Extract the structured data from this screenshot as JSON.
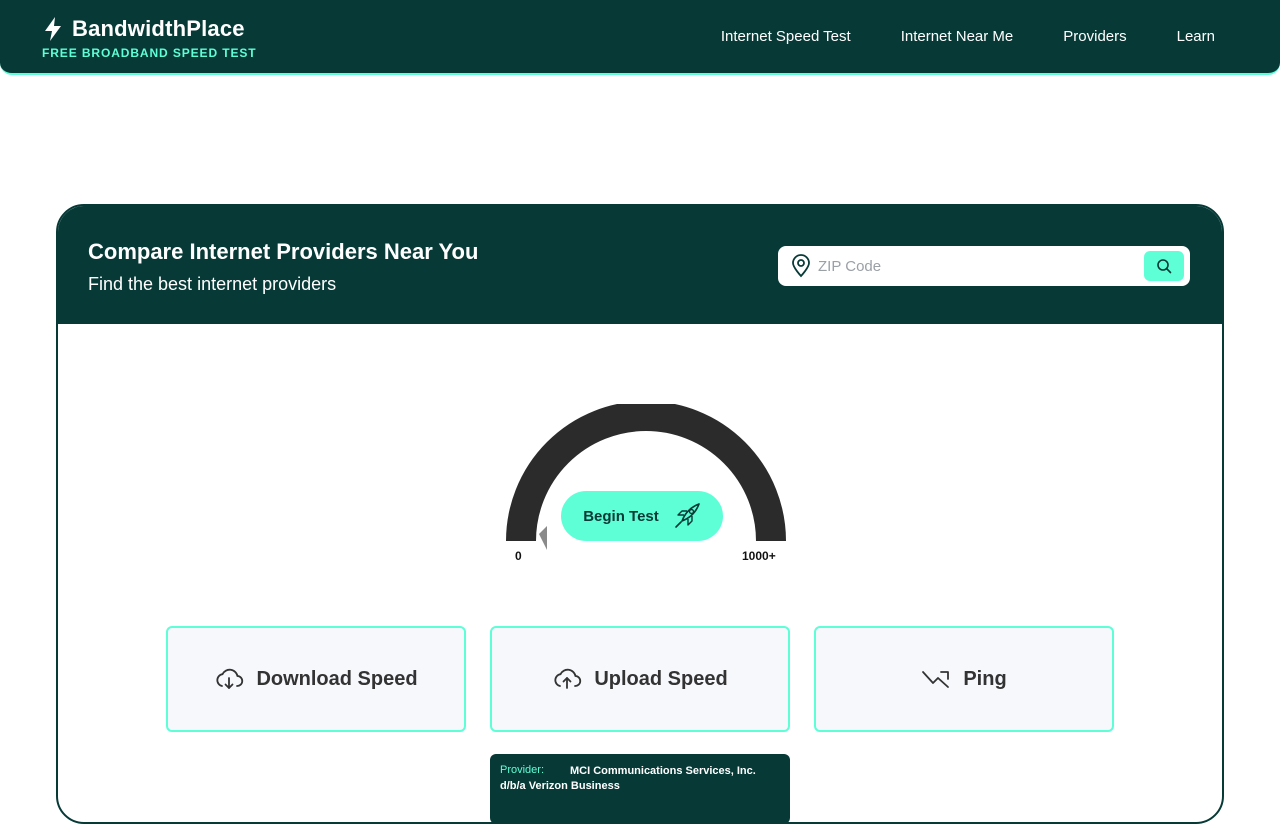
{
  "header": {
    "logo_name": "BandwidthPlace",
    "logo_tagline": "FREE BROADBAND SPEED TEST",
    "nav": [
      {
        "label": "Internet Speed Test"
      },
      {
        "label": "Internet Near Me"
      },
      {
        "label": "Providers"
      },
      {
        "label": "Learn"
      }
    ]
  },
  "card": {
    "title": "Compare Internet Providers Near You",
    "subtitle": "Find the best internet providers",
    "zip_placeholder": "ZIP Code"
  },
  "gauge": {
    "button_label": "Begin Test",
    "min_label": "0",
    "max_label": "1000+"
  },
  "metrics": [
    {
      "label": "Download Speed",
      "icon": "cloud-download-icon"
    },
    {
      "label": "Upload Speed",
      "icon": "cloud-upload-icon"
    },
    {
      "label": "Ping",
      "icon": "trend-icon"
    }
  ],
  "provider": {
    "label": "Provider:",
    "value": "MCI Communications Services, Inc. d/b/a Verizon Business"
  },
  "colors": {
    "brand_dark": "#073a37",
    "accent": "#5effd6"
  }
}
